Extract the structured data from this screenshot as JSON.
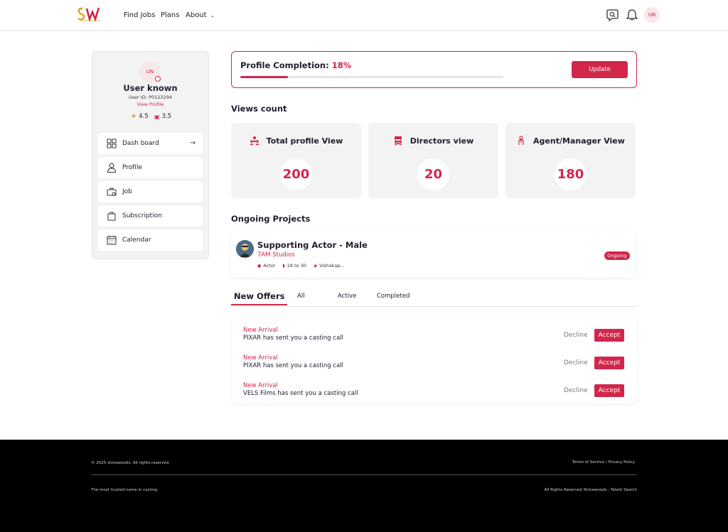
{
  "header": {
    "nav": [
      "Find Jobs",
      "Plans",
      "About"
    ],
    "avatar_initials": "UN",
    "colors": {
      "accent": "#d2264b",
      "logo_gold": "#e0a323"
    }
  },
  "sidebar": {
    "avatar_initials": "UN",
    "name": "User known",
    "user_id": "User ID:  P0123294",
    "view_profile": "View Profile",
    "rating_star": "4.5",
    "rating_book": "3.5",
    "menu": [
      {
        "label": "Dash board",
        "icon": "dashboard-icon"
      },
      {
        "label": "Profile",
        "icon": "user-icon"
      },
      {
        "label": "Job",
        "icon": "job-icon"
      },
      {
        "label": "Subscription",
        "icon": "bag-icon"
      },
      {
        "label": "Calendar",
        "icon": "calendar-icon"
      }
    ]
  },
  "profile_completion": {
    "label": "Profile Completion: ",
    "percent_text": "18%",
    "percent": 18,
    "button": "Update"
  },
  "views": {
    "title": "Views count",
    "cards": [
      {
        "label": "Total profile View",
        "value": "200",
        "icon": "people-icon"
      },
      {
        "label": "Directors view",
        "value": "20",
        "icon": "director-chair-icon"
      },
      {
        "label": "Agent/Manager View",
        "value": "180",
        "icon": "agent-icon"
      }
    ]
  },
  "projects": {
    "title": "Ongoing Projects",
    "item": {
      "title": "Supporting Actor - Male",
      "studio": "7AM Studios",
      "tags": [
        "Actor",
        "18 to 30",
        "Vishakap..."
      ],
      "status": "Ongoing"
    }
  },
  "tabs": [
    "New Offers",
    "All",
    "Active",
    "Completed"
  ],
  "offers": [
    {
      "tag": "New Arrival",
      "message": "PIXAR has sent you a casting call",
      "decline": "Decline",
      "accept": "Accept"
    },
    {
      "tag": "New Arrival",
      "message": "PIXAR has sent you a casting call",
      "decline": "Decline",
      "accept": "Accept"
    },
    {
      "tag": "New Arrival",
      "message": "VELS Films has sent you a casting call",
      "decline": "Decline",
      "accept": "Accept"
    }
  ],
  "footer": {
    "copyright": "© 2025 shinewoods. All rights reserved.",
    "links": "Terms of Service / Privacy Policy",
    "tagline": "The most trusted name in casting.",
    "rights": "All Rights Reserved Shinewoods - Talent Search"
  }
}
